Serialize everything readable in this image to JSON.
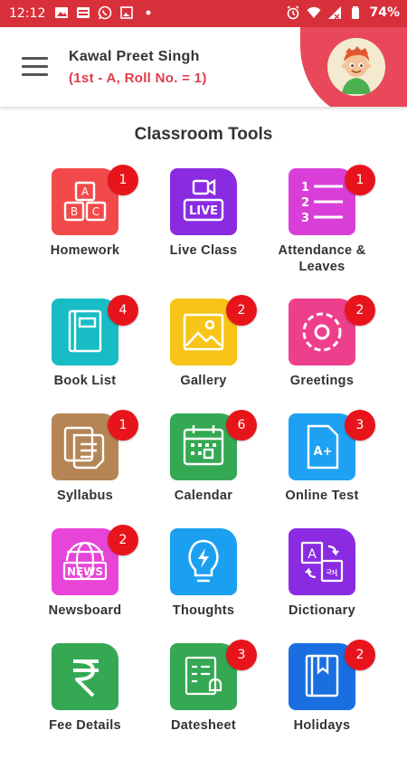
{
  "status_bar": {
    "time": "12:12",
    "battery": "74%",
    "icons": [
      "image-icon",
      "news-icon",
      "whatsapp-icon",
      "gallery-icon",
      "dot-icon",
      "alarm-icon",
      "wifi-icon",
      "signal-icon",
      "battery-icon"
    ]
  },
  "header": {
    "name": "Kawal Preet Singh",
    "subtitle": "(1st - A, Roll No. = 1)",
    "accent_color": "#e8485a"
  },
  "section_title": "Classroom Tools",
  "tools": [
    {
      "label": "Homework",
      "badge": "1",
      "icon": "abc-blocks-icon",
      "color": "#f24a4a"
    },
    {
      "label": "Live Class",
      "badge": "",
      "icon": "live-camera-icon",
      "color": "#8a2be2"
    },
    {
      "label": "Attendance &\nLeaves",
      "badge": "1",
      "icon": "numbered-list-icon",
      "color": "#d93fd8"
    },
    {
      "label": "Book List",
      "badge": "4",
      "icon": "book-icon",
      "color": "#17bcc4"
    },
    {
      "label": "Gallery",
      "badge": "2",
      "icon": "picture-icon",
      "color": "#f7c517"
    },
    {
      "label": "Greetings",
      "badge": "2",
      "icon": "greeting-circle-icon",
      "color": "#ee3f8c"
    },
    {
      "label": "Syllabus",
      "badge": "1",
      "icon": "documents-icon",
      "color": "#b58555"
    },
    {
      "label": "Calendar",
      "badge": "6",
      "icon": "calendar-icon",
      "color": "#34a853"
    },
    {
      "label": "Online Test",
      "badge": "3",
      "icon": "test-paper-icon",
      "color": "#1ea1f2"
    },
    {
      "label": "Newsboard",
      "badge": "2",
      "icon": "news-globe-icon",
      "color": "#e944d8"
    },
    {
      "label": "Thoughts",
      "badge": "",
      "icon": "bulb-icon",
      "color": "#1b9ff0"
    },
    {
      "label": "Dictionary",
      "badge": "",
      "icon": "translate-icon",
      "color": "#8a2be2"
    },
    {
      "label": "Fee Details",
      "badge": "",
      "icon": "rupee-icon",
      "color": "#34a853"
    },
    {
      "label": "Datesheet",
      "badge": "3",
      "icon": "datesheet-icon",
      "color": "#34a853"
    },
    {
      "label": "Holidays",
      "badge": "2",
      "icon": "holiday-book-icon",
      "color": "#1a6fe0"
    }
  ]
}
